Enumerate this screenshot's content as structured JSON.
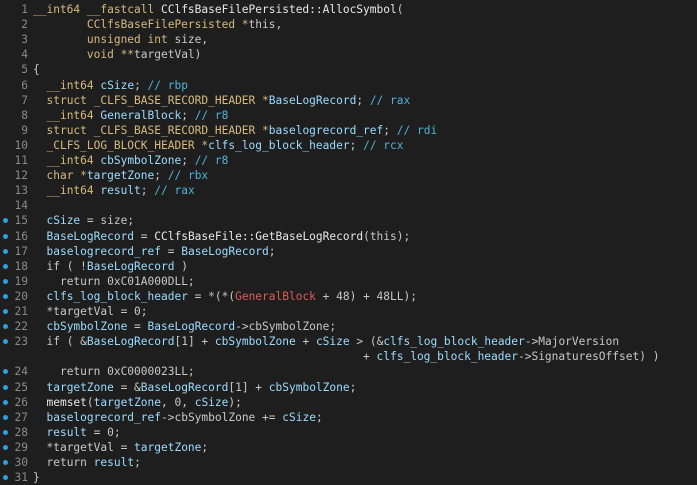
{
  "colors": {
    "background": "#1e1e1e",
    "line_number": "#8a8a8a",
    "breakpoint": "#2ea0e0",
    "keyword": "#d7ba7d",
    "local": "#9cdcfe",
    "global": "#e05a5a",
    "comment": "#4fb3d9",
    "plain": "#c8c8c8"
  },
  "lines": [
    {
      "n": "1",
      "bp": false,
      "indent": "",
      "tokens": [
        [
          "kw",
          "__int64 __fastcall "
        ],
        [
          "func",
          "CClfsBaseFilePersisted::AllocSymbol"
        ],
        [
          "plain",
          "("
        ]
      ]
    },
    {
      "n": "2",
      "bp": false,
      "indent": "        ",
      "tokens": [
        [
          "kw",
          "CClfsBaseFilePersisted *"
        ],
        [
          "plain",
          "this,"
        ]
      ]
    },
    {
      "n": "3",
      "bp": false,
      "indent": "        ",
      "tokens": [
        [
          "kw",
          "unsigned int "
        ],
        [
          "plain",
          "size,"
        ]
      ]
    },
    {
      "n": "4",
      "bp": false,
      "indent": "        ",
      "tokens": [
        [
          "kw",
          "void **"
        ],
        [
          "plain",
          "targetVal)"
        ]
      ]
    },
    {
      "n": "5",
      "bp": false,
      "indent": "",
      "tokens": [
        [
          "plain",
          "{"
        ]
      ]
    },
    {
      "n": "6",
      "bp": false,
      "indent": "  ",
      "tokens": [
        [
          "kw",
          "__int64 "
        ],
        [
          "local",
          "cSize"
        ],
        [
          "plain",
          "; "
        ],
        [
          "cmt",
          "// rbp"
        ]
      ]
    },
    {
      "n": "7",
      "bp": false,
      "indent": "  ",
      "tokens": [
        [
          "kw",
          "struct _CLFS_BASE_RECORD_HEADER *"
        ],
        [
          "local",
          "BaseLogRecord"
        ],
        [
          "plain",
          "; "
        ],
        [
          "cmt",
          "// rax"
        ]
      ]
    },
    {
      "n": "8",
      "bp": false,
      "indent": "  ",
      "tokens": [
        [
          "kw",
          "__int64 "
        ],
        [
          "local",
          "GeneralBlock"
        ],
        [
          "plain",
          "; "
        ],
        [
          "cmt",
          "// r8"
        ]
      ]
    },
    {
      "n": "9",
      "bp": false,
      "indent": "  ",
      "tokens": [
        [
          "kw",
          "struct _CLFS_BASE_RECORD_HEADER *"
        ],
        [
          "local",
          "baselogrecord_ref"
        ],
        [
          "plain",
          "; "
        ],
        [
          "cmt",
          "// rdi"
        ]
      ]
    },
    {
      "n": "10",
      "bp": false,
      "indent": "  ",
      "tokens": [
        [
          "kw",
          "_CLFS_LOG_BLOCK_HEADER *"
        ],
        [
          "local",
          "clfs_log_block_header"
        ],
        [
          "plain",
          "; "
        ],
        [
          "cmt",
          "// rcx"
        ]
      ]
    },
    {
      "n": "11",
      "bp": false,
      "indent": "  ",
      "tokens": [
        [
          "kw",
          "__int64 "
        ],
        [
          "local",
          "cbSymbolZone"
        ],
        [
          "plain",
          "; "
        ],
        [
          "cmt",
          "// r8"
        ]
      ]
    },
    {
      "n": "12",
      "bp": false,
      "indent": "  ",
      "tokens": [
        [
          "kw",
          "char *"
        ],
        [
          "local",
          "targetZone"
        ],
        [
          "plain",
          "; "
        ],
        [
          "cmt",
          "// rbx"
        ]
      ]
    },
    {
      "n": "13",
      "bp": false,
      "indent": "  ",
      "tokens": [
        [
          "kw",
          "__int64 "
        ],
        [
          "local",
          "result"
        ],
        [
          "plain",
          "; "
        ],
        [
          "cmt",
          "// rax"
        ]
      ]
    },
    {
      "n": "14",
      "bp": false,
      "indent": "",
      "tokens": []
    },
    {
      "n": "15",
      "bp": true,
      "indent": "  ",
      "tokens": [
        [
          "local",
          "cSize"
        ],
        [
          "plain",
          " = size;"
        ]
      ]
    },
    {
      "n": "16",
      "bp": true,
      "indent": "  ",
      "tokens": [
        [
          "local",
          "BaseLogRecord"
        ],
        [
          "plain",
          " = "
        ],
        [
          "func",
          "CClfsBaseFile::GetBaseLogRecord"
        ],
        [
          "plain",
          "(this);"
        ]
      ]
    },
    {
      "n": "17",
      "bp": true,
      "indent": "  ",
      "tokens": [
        [
          "local",
          "baselogrecord_ref"
        ],
        [
          "plain",
          " = "
        ],
        [
          "local",
          "BaseLogRecord"
        ],
        [
          "plain",
          ";"
        ]
      ]
    },
    {
      "n": "18",
      "bp": true,
      "indent": "  ",
      "tokens": [
        [
          "plain",
          "if ( !"
        ],
        [
          "local",
          "BaseLogRecord"
        ],
        [
          "plain",
          " )"
        ]
      ]
    },
    {
      "n": "19",
      "bp": true,
      "indent": "    ",
      "tokens": [
        [
          "plain",
          "return 0xC01A000DLL;"
        ]
      ]
    },
    {
      "n": "20",
      "bp": true,
      "indent": "  ",
      "tokens": [
        [
          "local",
          "clfs_log_block_header"
        ],
        [
          "plain",
          " = *(*("
        ],
        [
          "red",
          "GeneralBlock"
        ],
        [
          "plain",
          " + 48) + 48LL);"
        ]
      ]
    },
    {
      "n": "21",
      "bp": true,
      "indent": "  ",
      "tokens": [
        [
          "plain",
          "*targetVal = 0;"
        ]
      ]
    },
    {
      "n": "22",
      "bp": true,
      "indent": "  ",
      "tokens": [
        [
          "local",
          "cbSymbolZone"
        ],
        [
          "plain",
          " = "
        ],
        [
          "local",
          "BaseLogRecord"
        ],
        [
          "plain",
          "->cbSymbolZone;"
        ]
      ]
    },
    {
      "n": "23",
      "bp": true,
      "indent": "  ",
      "tokens": [
        [
          "plain",
          "if ( &"
        ],
        [
          "local",
          "BaseLogRecord"
        ],
        [
          "plain",
          "[1] + "
        ],
        [
          "local",
          "cbSymbolZone"
        ],
        [
          "plain",
          " + "
        ],
        [
          "local",
          "cSize"
        ],
        [
          "plain",
          " > (&"
        ],
        [
          "local",
          "clfs_log_block_header"
        ],
        [
          "plain",
          "->MajorVersion"
        ]
      ]
    },
    {
      "n": "",
      "bp": false,
      "indent": "                                                 ",
      "tokens": [
        [
          "plain",
          "+ "
        ],
        [
          "local",
          "clfs_log_block_header"
        ],
        [
          "plain",
          "->SignaturesOffset) )"
        ]
      ]
    },
    {
      "n": "24",
      "bp": true,
      "indent": "    ",
      "tokens": [
        [
          "plain",
          "return 0xC0000023LL;"
        ]
      ]
    },
    {
      "n": "25",
      "bp": true,
      "indent": "  ",
      "tokens": [
        [
          "local",
          "targetZone"
        ],
        [
          "plain",
          " = &"
        ],
        [
          "local",
          "BaseLogRecord"
        ],
        [
          "plain",
          "[1] + "
        ],
        [
          "local",
          "cbSymbolZone"
        ],
        [
          "plain",
          ";"
        ]
      ]
    },
    {
      "n": "26",
      "bp": true,
      "indent": "  ",
      "tokens": [
        [
          "func",
          "memset"
        ],
        [
          "plain",
          "("
        ],
        [
          "local",
          "targetZone"
        ],
        [
          "plain",
          ", 0, "
        ],
        [
          "local",
          "cSize"
        ],
        [
          "plain",
          ");"
        ]
      ]
    },
    {
      "n": "27",
      "bp": true,
      "indent": "  ",
      "tokens": [
        [
          "local",
          "baselogrecord_ref"
        ],
        [
          "plain",
          "->cbSymbolZone += "
        ],
        [
          "local",
          "cSize"
        ],
        [
          "plain",
          ";"
        ]
      ]
    },
    {
      "n": "28",
      "bp": true,
      "indent": "  ",
      "tokens": [
        [
          "local",
          "result"
        ],
        [
          "plain",
          " = 0;"
        ]
      ]
    },
    {
      "n": "29",
      "bp": true,
      "indent": "  ",
      "tokens": [
        [
          "plain",
          "*targetVal = "
        ],
        [
          "local",
          "targetZone"
        ],
        [
          "plain",
          ";"
        ]
      ]
    },
    {
      "n": "30",
      "bp": true,
      "indent": "  ",
      "tokens": [
        [
          "plain",
          "return "
        ],
        [
          "local",
          "result"
        ],
        [
          "plain",
          ";"
        ]
      ]
    },
    {
      "n": "31",
      "bp": true,
      "indent": "",
      "tokens": [
        [
          "plain",
          "}"
        ]
      ]
    }
  ]
}
